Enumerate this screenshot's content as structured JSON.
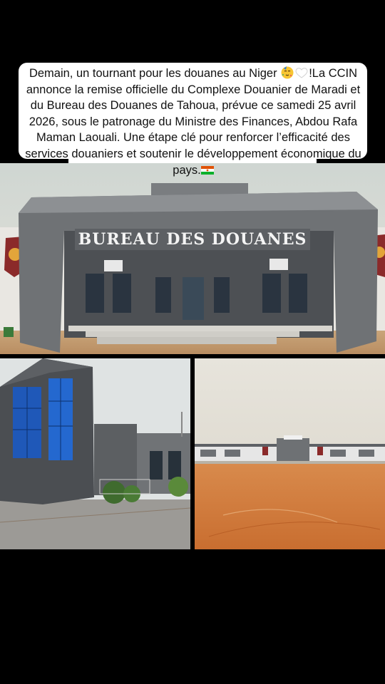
{
  "post": {
    "caption_part1": "Demain, un tournant pour les douanes au Niger",
    "caption_part2": "!La CCIN annonce la remise officielle du Complexe Douanier de Maradi et du Bureau des Douanes de Tahoua, prévue ce samedi 25 avril 2026, sous le patronage du Ministre des Finances, Abdou Rafa Maman Laouali. Une étape clé pour renforcer l’efficacité des services douaniers et soutenir le développement économique du pays.",
    "emojis": [
      "partying-face-emoji",
      "white-heart-emoji",
      "niger-flag-emoji"
    ]
  },
  "photos": {
    "main": {
      "sign_text": "BUREAU DES DOUANES"
    },
    "left": {
      "subject": "glass tower building"
    },
    "right": {
      "subject": "complex across open red-earth yard"
    }
  },
  "colors": {
    "background": "#000000",
    "caption_bg": "#ffffff",
    "caption_text": "#111111"
  }
}
